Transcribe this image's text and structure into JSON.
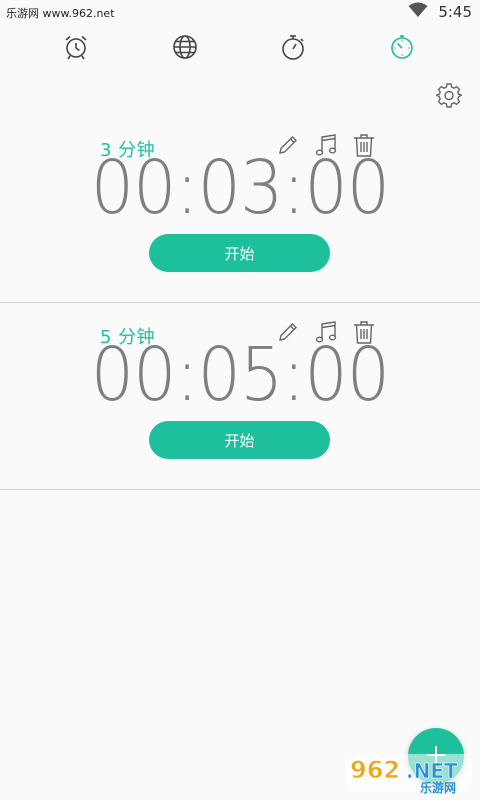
{
  "status_bar": {
    "watermark": "乐游网 www.962.net",
    "time": "5:45"
  },
  "tabs": [
    {
      "name": "alarm-clock-icon",
      "active": false
    },
    {
      "name": "globe-icon",
      "active": false
    },
    {
      "name": "stopwatch-icon",
      "active": false
    },
    {
      "name": "timer-icon",
      "active": true
    }
  ],
  "colors": {
    "accent": "#1dbf9d",
    "icon_gray": "#555555",
    "digits": "#7f7f7f"
  },
  "timers": [
    {
      "label": "3 分钟",
      "display": "00:03:00",
      "button": "开始"
    },
    {
      "label": "5 分钟",
      "display": "00:05:00",
      "button": "开始"
    }
  ],
  "fab": {
    "icon": "plus-icon"
  },
  "watermark_logo": {
    "text": "962.NET 乐游网"
  }
}
